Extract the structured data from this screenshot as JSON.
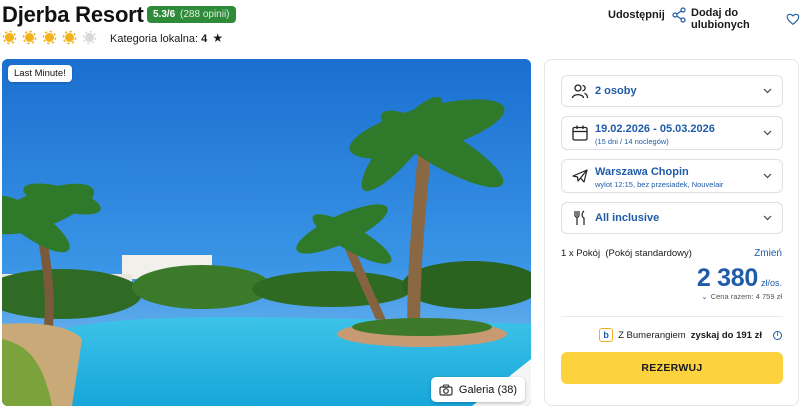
{
  "hotel": {
    "name": "Djerba Resort",
    "rating_score": "5.3/6",
    "rating_reviews": "(288 opinii)",
    "stars_total": 5,
    "stars_filled": 4,
    "local_category_label": "Kategoria lokalna:",
    "local_category_value": "4",
    "local_category_icon": "star-icon"
  },
  "actions": {
    "share_label": "Udostępnij",
    "share_icon": "share-icon",
    "favorite_label": "Dodaj do ulubionych",
    "favorite_icon": "heart-icon"
  },
  "photo": {
    "badge": "Last Minute!",
    "gallery_label": "Galeria (38)",
    "gallery_icon": "camera-icon"
  },
  "booking": {
    "guests": {
      "label": "2 osoby",
      "icon": "people-icon"
    },
    "dates": {
      "label": "19.02.2026 - 05.03.2026",
      "sub": "(15 dni / 14 noclegów)",
      "icon": "calendar-icon"
    },
    "departure": {
      "label": "Warszawa Chopin",
      "sub": "wylot 12:15, bez przesiadek, Nouvelair",
      "icon": "plane-icon"
    },
    "board": {
      "label": "All inclusive",
      "icon": "cutlery-icon"
    },
    "room_qty": "1 x Pokój",
    "room_type": "(Pokój standardowy)",
    "change_link": "Zmień",
    "price_amount": "2 380",
    "price_unit": "zł/os.",
    "total_label": "Cena razem: 4 759 zł",
    "bumerang_prefix": "Z Bumerangiem",
    "bumerang_bold": "zyskaj do 191 zł",
    "reserve_button": "REZERWUJ"
  },
  "colors": {
    "accent_blue": "#1f5ba8",
    "rating_green": "#2e8b3a",
    "reserve_yellow": "#fcd23f",
    "sun_active": "#f3b21c",
    "sun_inactive": "#d9d9d9"
  }
}
